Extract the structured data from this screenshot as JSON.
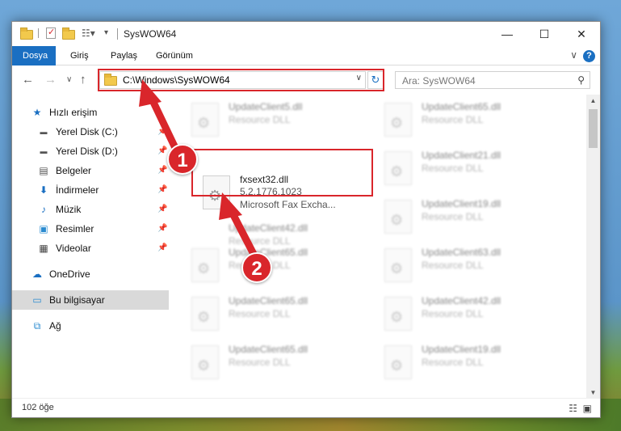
{
  "window": {
    "title": "SysWOW64",
    "minimize": "—",
    "maximize": "☐",
    "close": "✕"
  },
  "ribbon": {
    "tabs": [
      {
        "label": "Dosya",
        "active": true
      },
      {
        "label": "Giriş"
      },
      {
        "label": "Paylaş"
      },
      {
        "label": "Görünüm"
      }
    ],
    "expand": "∨",
    "help": "?"
  },
  "nav": {
    "back": "←",
    "forward": "→",
    "recent": "∨",
    "up": "↑",
    "address": "C:\\Windows\\SysWOW64",
    "refresh": "↻",
    "search_placeholder": "Ara: SysWOW64"
  },
  "sidebar": {
    "items": [
      {
        "label": "Hızlı erişim",
        "icon": "star-icon"
      },
      {
        "label": "Yerel Disk (C:)",
        "icon": "drive-icon",
        "pinned": true
      },
      {
        "label": "Yerel Disk (D:)",
        "icon": "drive-icon",
        "pinned": true
      },
      {
        "label": "Belgeler",
        "icon": "documents-icon",
        "pinned": true
      },
      {
        "label": "İndirmeler",
        "icon": "download-icon",
        "pinned": true
      },
      {
        "label": "Müzik",
        "icon": "music-icon",
        "pinned": true
      },
      {
        "label": "Resimler",
        "icon": "pictures-icon",
        "pinned": true
      },
      {
        "label": "Videolar",
        "icon": "video-icon",
        "pinned": true
      },
      {
        "label": "OneDrive",
        "icon": "cloud-icon"
      },
      {
        "label": "Bu bilgisayar",
        "icon": "computer-icon",
        "selected": true
      },
      {
        "label": "Ağ",
        "icon": "network-icon"
      }
    ]
  },
  "files": {
    "highlighted": {
      "name": "fxsext32.dll",
      "version": "5.2.1776.1023",
      "description": "Microsoft Fax Excha..."
    },
    "left": [
      {
        "name": "UpdateClient5.dll",
        "desc": "Resource DLL"
      },
      {
        "name": "UpdateClient42.dll",
        "desc": "Resource DLL"
      },
      {
        "name": "UpdateClient65.dll",
        "desc": "Resource DLL"
      },
      {
        "name": "UpdateClient65.dll",
        "desc": "Resource DLL"
      },
      {
        "name": "UpdateClient65.dll",
        "desc": "Resource DLL"
      }
    ],
    "right": [
      {
        "name": "UpdateClient65.dll",
        "desc": "Resource DLL"
      },
      {
        "name": "UpdateClient21.dll",
        "desc": "Resource DLL"
      },
      {
        "name": "UpdateClient19.dll",
        "desc": "Resource DLL"
      },
      {
        "name": "UpdateClient63.dll",
        "desc": "Resource DLL"
      },
      {
        "name": "UpdateClient42.dll",
        "desc": "Resource DLL"
      },
      {
        "name": "UpdateClient19.dll",
        "desc": "Resource DLL"
      }
    ]
  },
  "status": {
    "count": "102 öğe"
  },
  "annotations": {
    "badge1": "1",
    "badge2": "2",
    "color": "#d9262b"
  }
}
